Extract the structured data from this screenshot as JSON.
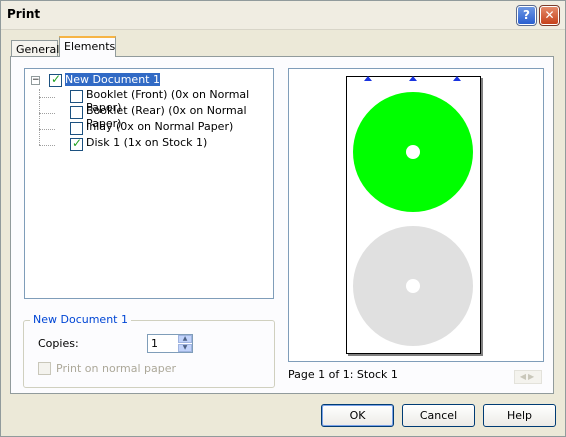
{
  "window": {
    "title": "Print",
    "help_glyph": "?",
    "close_glyph": "✕"
  },
  "tabs": [
    {
      "label": "General"
    },
    {
      "label": "Elements"
    }
  ],
  "tree": {
    "root": {
      "label": "New Document 1",
      "checked": true,
      "expander": "−"
    },
    "items": [
      {
        "label": "Booklet  (Front) (0x on Normal Paper)",
        "checked": false
      },
      {
        "label": "Booklet  (Rear) (0x on Normal Paper)",
        "checked": false
      },
      {
        "label": "Inlay (0x on Normal Paper)",
        "checked": false
      },
      {
        "label": "Disk 1 (1x on Stock 1)",
        "checked": true
      }
    ]
  },
  "group": {
    "title": "New Document 1",
    "copies_label": "Copies:",
    "copies_value": "1",
    "print_normal_label": "Print on normal paper",
    "print_normal_checked": false
  },
  "preview": {
    "status": "Page 1 of 1: Stock 1",
    "disc_active_color": "#00ff00",
    "disc_inactive_color": "#e0e0e0",
    "marker_color": "#1a34e0"
  },
  "buttons": {
    "ok": "OK",
    "cancel": "Cancel",
    "help": "Help"
  }
}
